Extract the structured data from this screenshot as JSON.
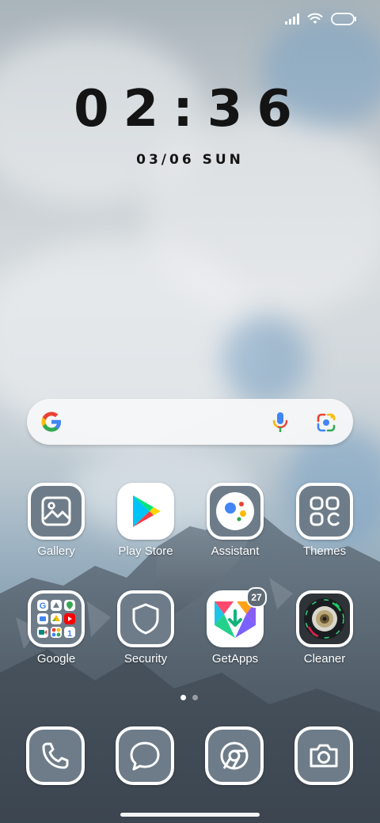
{
  "status_bar": {
    "icons": [
      "signal-icon",
      "wifi-icon",
      "battery-icon"
    ]
  },
  "clock": {
    "time": "02:36",
    "date": "03/06 SUN"
  },
  "search": {
    "icons": [
      "google-g-icon",
      "voice-search-icon",
      "google-lens-icon"
    ]
  },
  "apps": [
    {
      "label": "Gallery",
      "icon": "gallery-icon"
    },
    {
      "label": "Play Store",
      "icon": "play-store-icon"
    },
    {
      "label": "Assistant",
      "icon": "assistant-icon"
    },
    {
      "label": "Themes",
      "icon": "themes-icon"
    },
    {
      "label": "Google",
      "icon": "google-folder-icon"
    },
    {
      "label": "Security",
      "icon": "shield-icon"
    },
    {
      "label": "GetApps",
      "icon": "getapps-icon",
      "badge": "27"
    },
    {
      "label": "Cleaner",
      "icon": "cleaner-icon"
    }
  ],
  "page_indicator": {
    "count": 2,
    "active": 0
  },
  "dock": [
    {
      "icon": "phone-icon"
    },
    {
      "icon": "messages-icon"
    },
    {
      "icon": "chrome-icon"
    },
    {
      "icon": "camera-icon"
    }
  ],
  "colors": {
    "tile_bg": "#6e7c89",
    "tile_border": "#ffffff",
    "clock_text": "#141414"
  }
}
